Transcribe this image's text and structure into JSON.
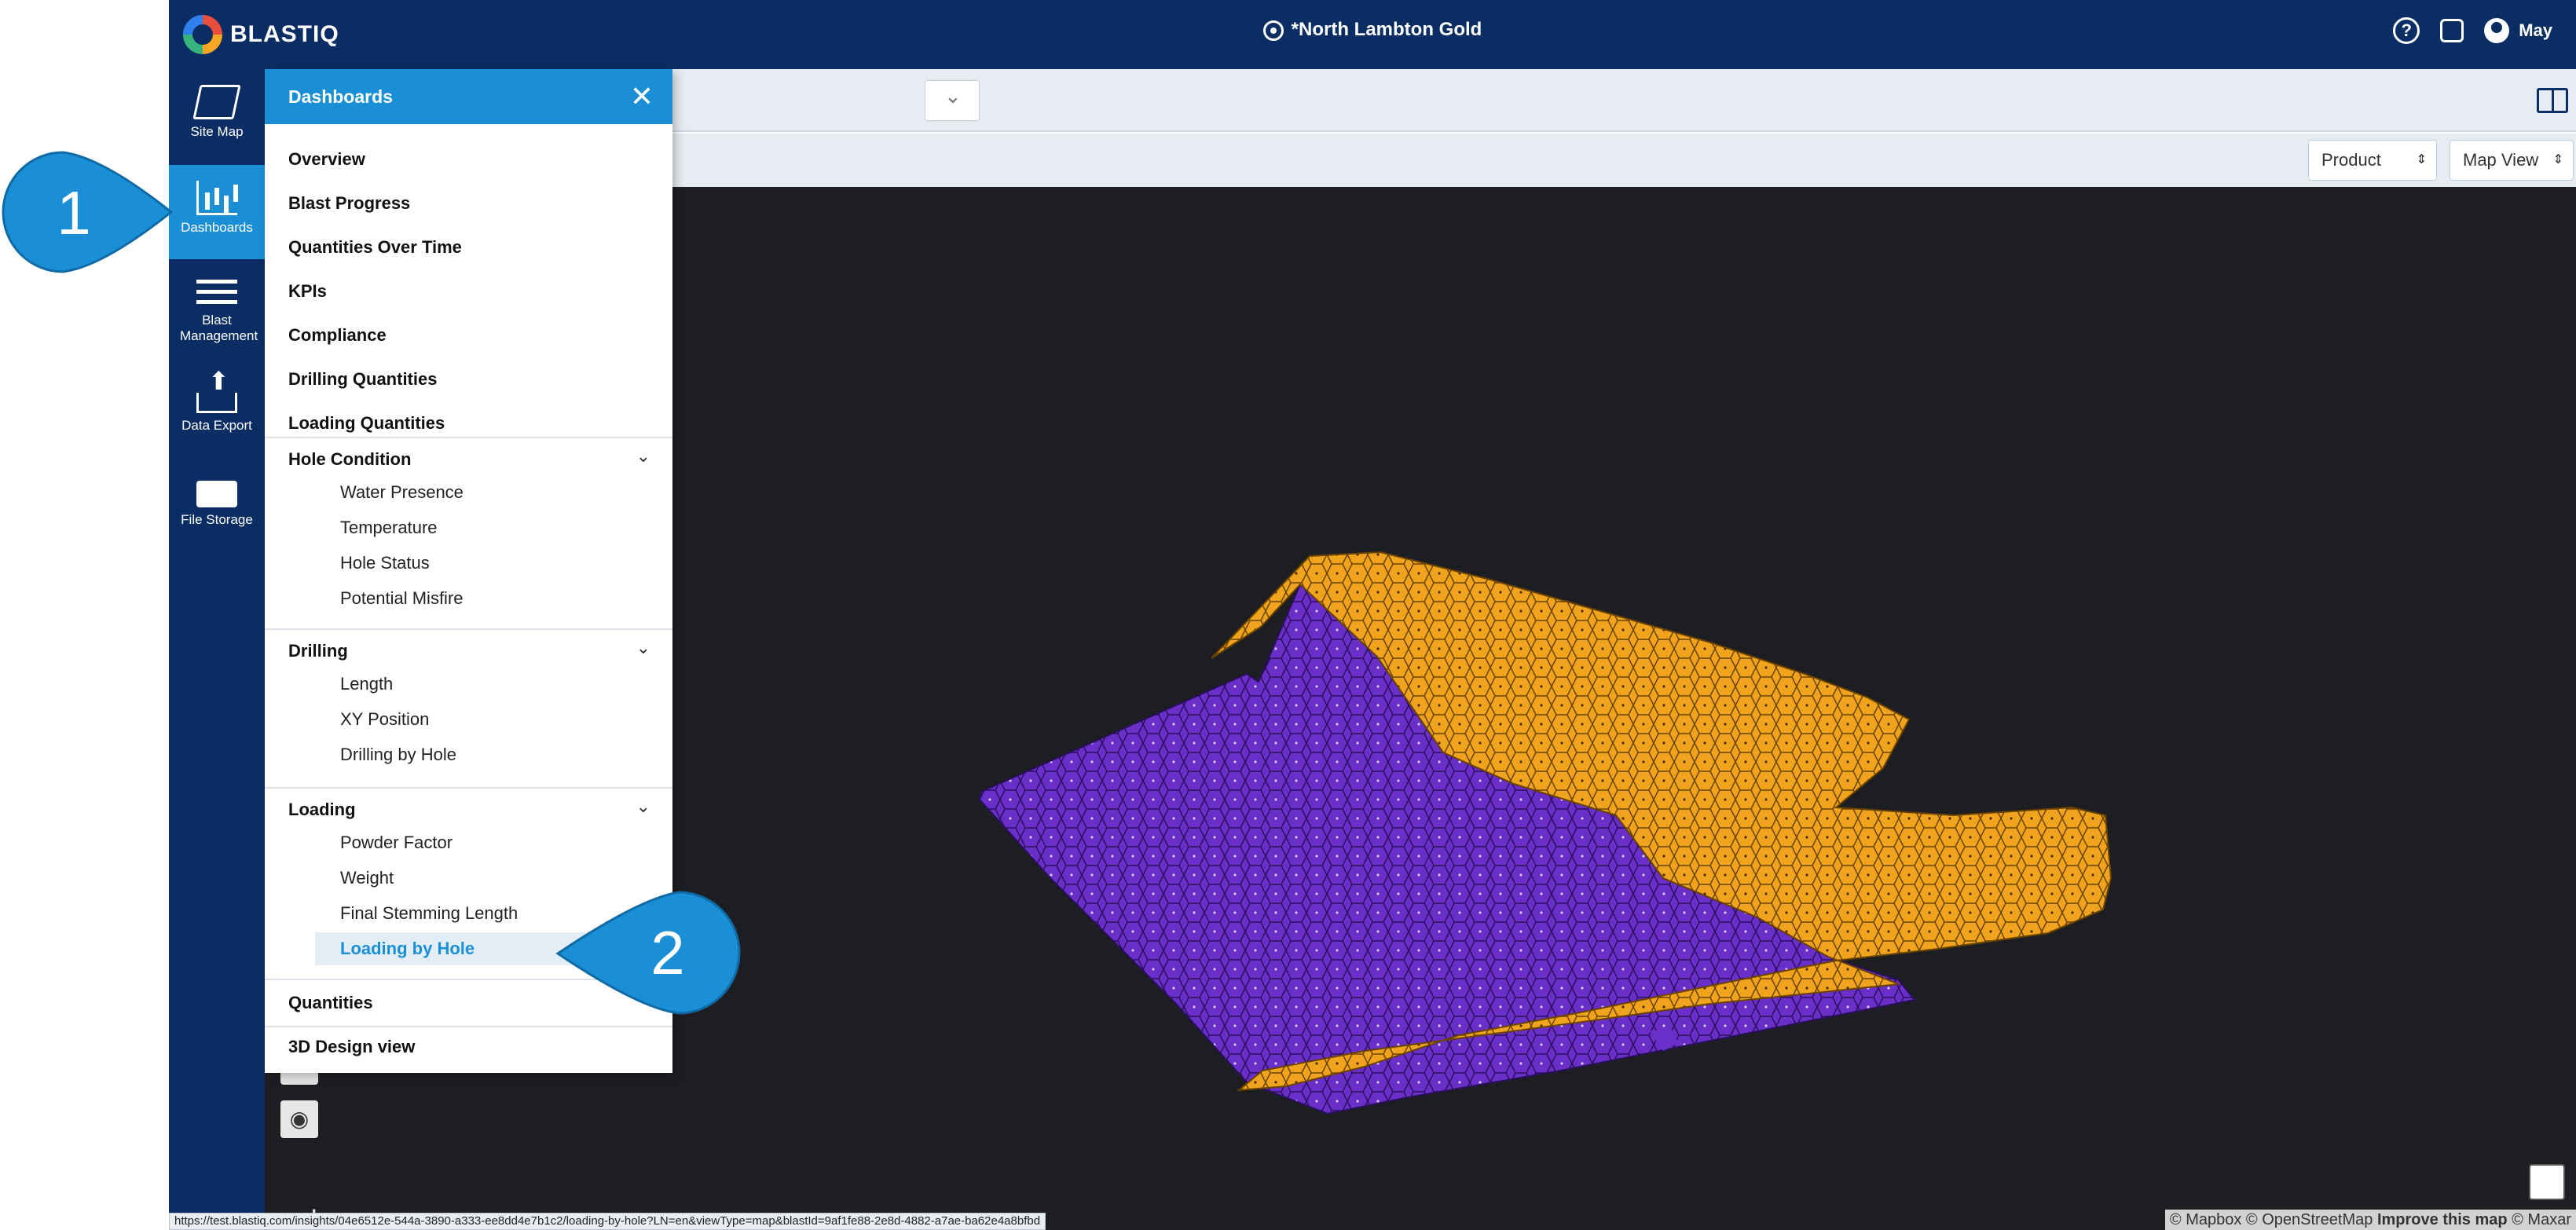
{
  "header": {
    "logo_text": "BLASTIQ",
    "site_title": "*North Lambton Gold",
    "help_label": "?",
    "user_name": "May"
  },
  "rail": {
    "items": [
      {
        "label": "Site Map",
        "icon": "map-icon"
      },
      {
        "label": "Dashboards",
        "icon": "dashboard-chart-icon"
      },
      {
        "label": "Blast Management",
        "icon": "list-icon"
      },
      {
        "label": "Data Export",
        "icon": "upload-icon"
      },
      {
        "label": "File Storage",
        "icon": "folder-icon"
      }
    ]
  },
  "toolbar": {
    "product_select": "Product",
    "view_select": "Map View"
  },
  "panel": {
    "title": "Dashboards",
    "top_items": [
      "Overview",
      "Blast Progress",
      "Quantities Over Time",
      "KPIs",
      "Compliance",
      "Drilling Quantities",
      "Loading Quantities"
    ],
    "hole_condition": {
      "label": "Hole Condition",
      "items": [
        "Water Presence",
        "Temperature",
        "Hole Status",
        "Potential Misfire"
      ]
    },
    "drilling": {
      "label": "Drilling",
      "items": [
        "Length",
        "XY Position",
        "Drilling by Hole"
      ]
    },
    "loading": {
      "label": "Loading",
      "items": [
        "Powder Factor",
        "Weight",
        "Final Stemming Length",
        "Loading by Hole"
      ]
    },
    "bottom_items": [
      "Quantities",
      "3D Design view"
    ]
  },
  "map": {
    "attribution": "© Mapbox © OpenStreetMap",
    "improve_link": "Improve this map",
    "attribution_tail": "© Maxar",
    "mapbox_logo": "mapbox",
    "colors": {
      "product_a": "#6a2fc9",
      "product_b": "#f0a31c",
      "background": "#1d1e22"
    }
  },
  "status_url": "https://test.blastiq.com/insights/04e6512e-544a-3890-a333-ee8dd4e7b1c2/loading-by-hole?LN=en&viewType=map&blastId=9af1fe88-2e8d-4882-a7ae-ba62e4a8bfbd",
  "callouts": [
    "1",
    "2"
  ],
  "colors": {
    "navy": "#0a2e63",
    "accent": "#1a8fd6",
    "callout": "#1a8fd6"
  }
}
